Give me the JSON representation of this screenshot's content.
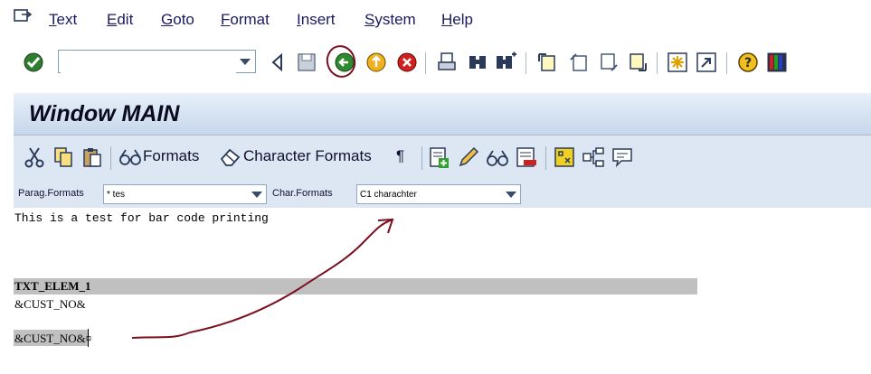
{
  "menu": {
    "items": [
      {
        "label": "Text",
        "ul": "T",
        "rest": "ext"
      },
      {
        "label": "Edit",
        "ul": "E",
        "rest": "dit"
      },
      {
        "label": "Goto",
        "ul": "G",
        "rest": "oto"
      },
      {
        "label": "Format",
        "ul": "F",
        "rest": "ormat"
      },
      {
        "label": "Insert",
        "ul": "I",
        "rest": "nsert"
      },
      {
        "label": "System",
        "ul": "S",
        "rest": "ystem"
      },
      {
        "label": "Help",
        "ul": "H",
        "rest": "elp"
      }
    ]
  },
  "toolbar": {
    "command_value": "",
    "icons": [
      "enter-icon",
      "back-triangle-icon",
      "save-icon",
      "back-icon",
      "exit-icon",
      "cancel-icon",
      "print-icon",
      "find-icon",
      "find-next-icon",
      "first-page-icon",
      "previous-page-icon",
      "next-page-icon",
      "last-page-icon",
      "create-session-icon",
      "shortcut-icon",
      "help-icon",
      "customize-layout-icon"
    ]
  },
  "title": "Window MAIN",
  "app_toolbar": {
    "formats_label": "Formats",
    "char_formats_label": "Character Formats",
    "paragraph_symbol": "¶"
  },
  "format_row": {
    "parag_label": "Parag.Formats",
    "parag_value": "* tes",
    "char_label": "Char.Formats",
    "char_value": "C1 charachter"
  },
  "editor": {
    "lines": [
      "This is a test for bar code printing",
      "TXT_ELEM_1",
      "&CUST_NO&",
      "&CUST_NO&¤"
    ]
  },
  "colors": {
    "accent_annotation": "#7a1020",
    "title_bg": "#c6d7ea",
    "toolbar_bg": "#dde7f3",
    "highlight": "#c0c0c0"
  }
}
